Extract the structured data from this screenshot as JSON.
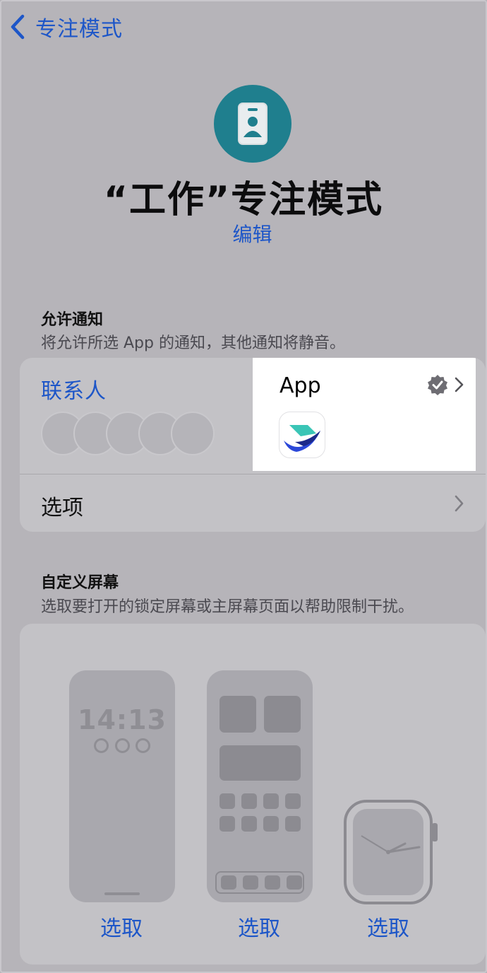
{
  "nav": {
    "back_label": "专注模式"
  },
  "header": {
    "icon": "id-badge-icon",
    "icon_color": "#1f7f8e",
    "title": "“工作”专注模式",
    "edit_label": "编辑"
  },
  "allow_notifications": {
    "title": "允许通知",
    "subtitle": "将允许所选 App 的通知，其他通知将静音。",
    "contacts_label": "联系人",
    "apps_label": "App",
    "options_label": "选项"
  },
  "custom_screens": {
    "title": "自定义屏幕",
    "subtitle": "选取要打开的锁定屏幕或主屏幕页面以帮助限制干扰。",
    "lock_screen_time": "14:13",
    "select_labels": [
      "选取",
      "选取",
      "选取"
    ]
  },
  "colors": {
    "accent": "#1d56c8",
    "background": "#b6b4b9"
  }
}
